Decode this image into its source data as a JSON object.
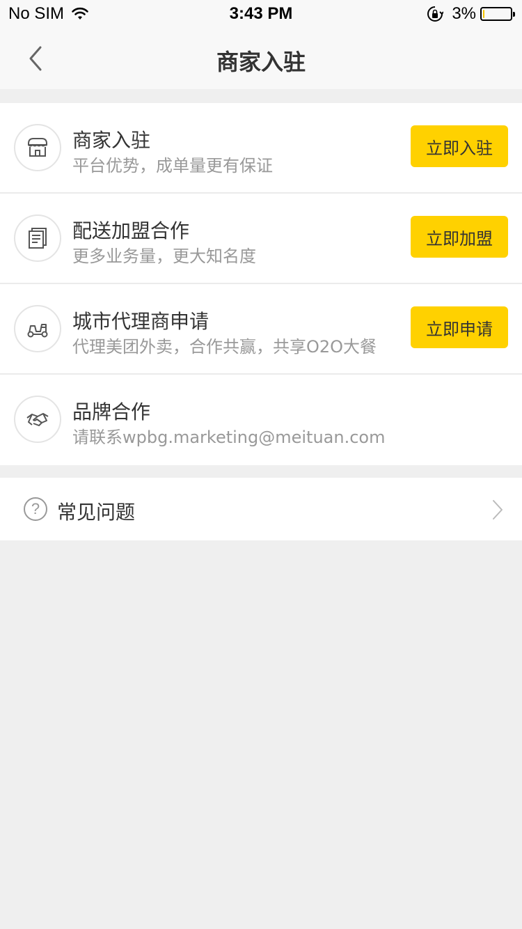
{
  "status_bar": {
    "carrier": "No SIM",
    "time": "3:43 PM",
    "battery_percent": "3%",
    "battery_level": 0.03,
    "battery_color": "#f5c400"
  },
  "nav": {
    "title": "商家入驻",
    "back_icon": "chevron-left-icon"
  },
  "items": [
    {
      "icon": "storefront-icon",
      "title": "商家入驻",
      "subtitle": "平台优势，成单量更有保证",
      "button": "立即入驻"
    },
    {
      "icon": "document-icon",
      "title": "配送加盟合作",
      "subtitle": "更多业务量，更大知名度",
      "button": "立即加盟"
    },
    {
      "icon": "delivery-vehicle-icon",
      "title": "城市代理商申请",
      "subtitle": "代理美团外卖，合作共赢，共享O2O大餐",
      "button": "立即申请"
    },
    {
      "icon": "handshake-icon",
      "title": "品牌合作",
      "subtitle": "请联系wpbg.marketing@meituan.com",
      "button": null
    }
  ],
  "faq": {
    "icon": "question-circle-icon",
    "label": "常见问题",
    "chevron_icon": "chevron-right-icon"
  },
  "colors": {
    "accent": "#ffd100",
    "background": "#efefef",
    "text_primary": "#333333",
    "text_secondary": "#999999"
  }
}
